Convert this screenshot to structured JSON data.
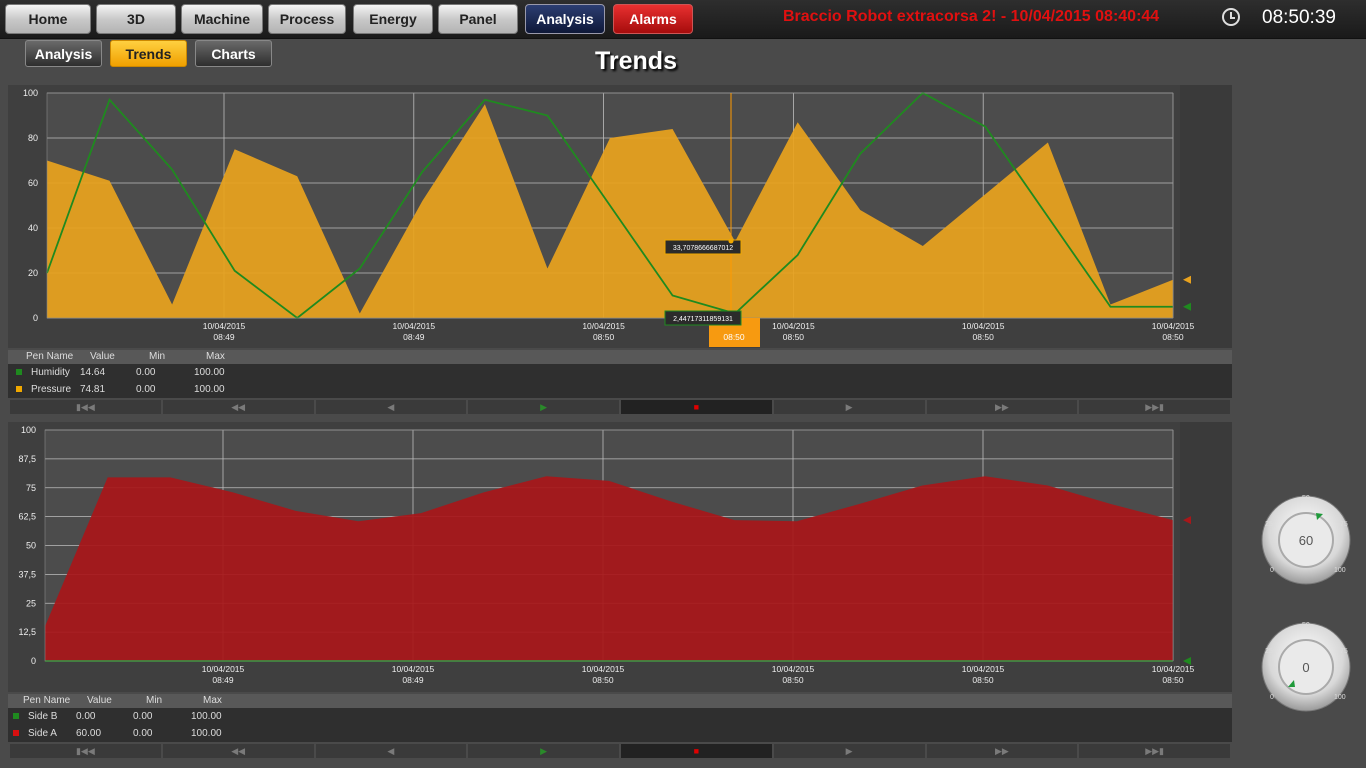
{
  "nav": {
    "home": "Home",
    "threeD": "3D",
    "machine": "Machine",
    "process": "Process",
    "energy": "Energy",
    "panel": "Panel",
    "analysis": "Analysis",
    "alarms": "Alarms"
  },
  "alarm_message": "Braccio Robot extracorsa 2! - 10/04/2015 08:40:44",
  "clock": {
    "icon": "clock-icon",
    "time": "08:50:39"
  },
  "subtabs": {
    "analysis": "Analysis",
    "trends": "Trends",
    "charts": "Charts"
  },
  "page_title": "Trends",
  "table1": {
    "headers": [
      "Pen Name",
      "Value",
      "Min",
      "Max"
    ],
    "rows": [
      {
        "name": "Humidity",
        "value": "14.64",
        "min": "0.00",
        "max": "100.00",
        "color": "#1f8a1f"
      },
      {
        "name": "Pressure",
        "value": "74.81",
        "min": "0.00",
        "max": "100.00",
        "color": "#f0a800"
      }
    ]
  },
  "table2": {
    "headers": [
      "Pen Name",
      "Value",
      "Min",
      "Max"
    ],
    "rows": [
      {
        "name": "Side B",
        "value": "0.00",
        "min": "0.00",
        "max": "100.00",
        "color": "#1f8a1f"
      },
      {
        "name": "Side A",
        "value": "60.00",
        "min": "0.00",
        "max": "100.00",
        "color": "#d81010"
      }
    ]
  },
  "playback_controls": [
    "first-icon",
    "rewind-icon",
    "step-back-icon",
    "play-icon",
    "stop-icon",
    "step-forward-icon",
    "fast-forward-icon",
    "last-icon"
  ],
  "knobs": [
    {
      "value": "60",
      "scale": [
        "0",
        "25",
        "50",
        "75",
        "100"
      ]
    },
    {
      "value": "0",
      "scale": [
        "0",
        "25",
        "50",
        "75",
        "100"
      ]
    }
  ],
  "chart_data": [
    {
      "type": "area",
      "yticks": [
        "0",
        "20",
        "40",
        "60",
        "80",
        "100"
      ],
      "ylim": [
        0,
        100
      ],
      "xticks": [
        {
          "date": "10/04/2015",
          "time": "08:49"
        },
        {
          "date": "10/04/2015",
          "time": "08:49"
        },
        {
          "date": "10/04/2015",
          "time": "08:50"
        },
        {
          "date": "10/04/2015",
          "time": "08:50"
        },
        {
          "date": "10/04/2015",
          "time": "08:50"
        },
        {
          "date": "10/04/2015",
          "time": "08:50"
        }
      ],
      "cursor": {
        "time": "08:50",
        "pressure_label": "33,7078666687012",
        "humidity_label": "2,44717311859131"
      },
      "series": [
        {
          "name": "Pressure",
          "kind": "area",
          "color": "#e8a21e",
          "values": [
            70,
            61,
            6,
            75,
            63,
            2,
            52,
            95,
            22,
            80,
            84,
            34,
            87,
            48,
            32,
            55,
            78,
            6,
            17
          ]
        },
        {
          "name": "Humidity",
          "kind": "line",
          "color": "#1f8a1f",
          "values": [
            20,
            97,
            66,
            21,
            0,
            22,
            65,
            97,
            90,
            50,
            10,
            2,
            28,
            73,
            100,
            85,
            45,
            5,
            5
          ]
        }
      ]
    },
    {
      "type": "area",
      "yticks": [
        "0",
        "12,5",
        "25",
        "37,5",
        "50",
        "62,5",
        "75",
        "87,5",
        "100"
      ],
      "ylim": [
        0,
        100
      ],
      "xticks": [
        {
          "date": "10/04/2015",
          "time": "08:49"
        },
        {
          "date": "10/04/2015",
          "time": "08:49"
        },
        {
          "date": "10/04/2015",
          "time": "08:50"
        },
        {
          "date": "10/04/2015",
          "time": "08:50"
        },
        {
          "date": "10/04/2015",
          "time": "08:50"
        },
        {
          "date": "10/04/2015",
          "time": "08:50"
        }
      ],
      "series": [
        {
          "name": "Side A",
          "kind": "area",
          "color": "#a8171a",
          "values": [
            15,
            79.5,
            79.5,
            73,
            65,
            60.5,
            64,
            73,
            80,
            78,
            69,
            61,
            60.5,
            68,
            76,
            80,
            76,
            68,
            61
          ]
        },
        {
          "name": "Side B",
          "kind": "line",
          "color": "#1f8a1f",
          "values": [
            0,
            0,
            0,
            0,
            0,
            0,
            0,
            0,
            0,
            0,
            0,
            0,
            0,
            0,
            0,
            0,
            0,
            0,
            0
          ]
        }
      ]
    }
  ]
}
